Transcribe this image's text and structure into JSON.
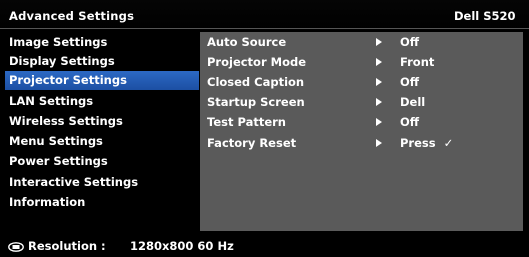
{
  "header": {
    "title": "Advanced Settings",
    "model": "Dell S520"
  },
  "sidebar": {
    "items": [
      {
        "label": "Image Settings"
      },
      {
        "label": "Display Settings"
      },
      {
        "label": "Projector Settings",
        "active": true
      },
      {
        "label": "LAN Settings"
      },
      {
        "label": "Wireless Settings"
      },
      {
        "label": "Menu Settings"
      },
      {
        "label": "Power Settings"
      },
      {
        "label": "Interactive Settings"
      },
      {
        "label": "Information"
      }
    ]
  },
  "panel": {
    "rows": [
      {
        "label": "Auto Source",
        "value": "Off"
      },
      {
        "label": "Projector Mode",
        "value": "Front"
      },
      {
        "label": "Closed Caption",
        "value": "Off"
      },
      {
        "label": "Startup Screen",
        "value": "Dell"
      },
      {
        "label": "Test Pattern",
        "value": "Off"
      },
      {
        "label": "Factory Reset",
        "value": "Press",
        "check": "✓"
      }
    ]
  },
  "status": {
    "icon": "monitor-icon",
    "label": "Resolution :",
    "value": "1280x800 60 Hz"
  }
}
